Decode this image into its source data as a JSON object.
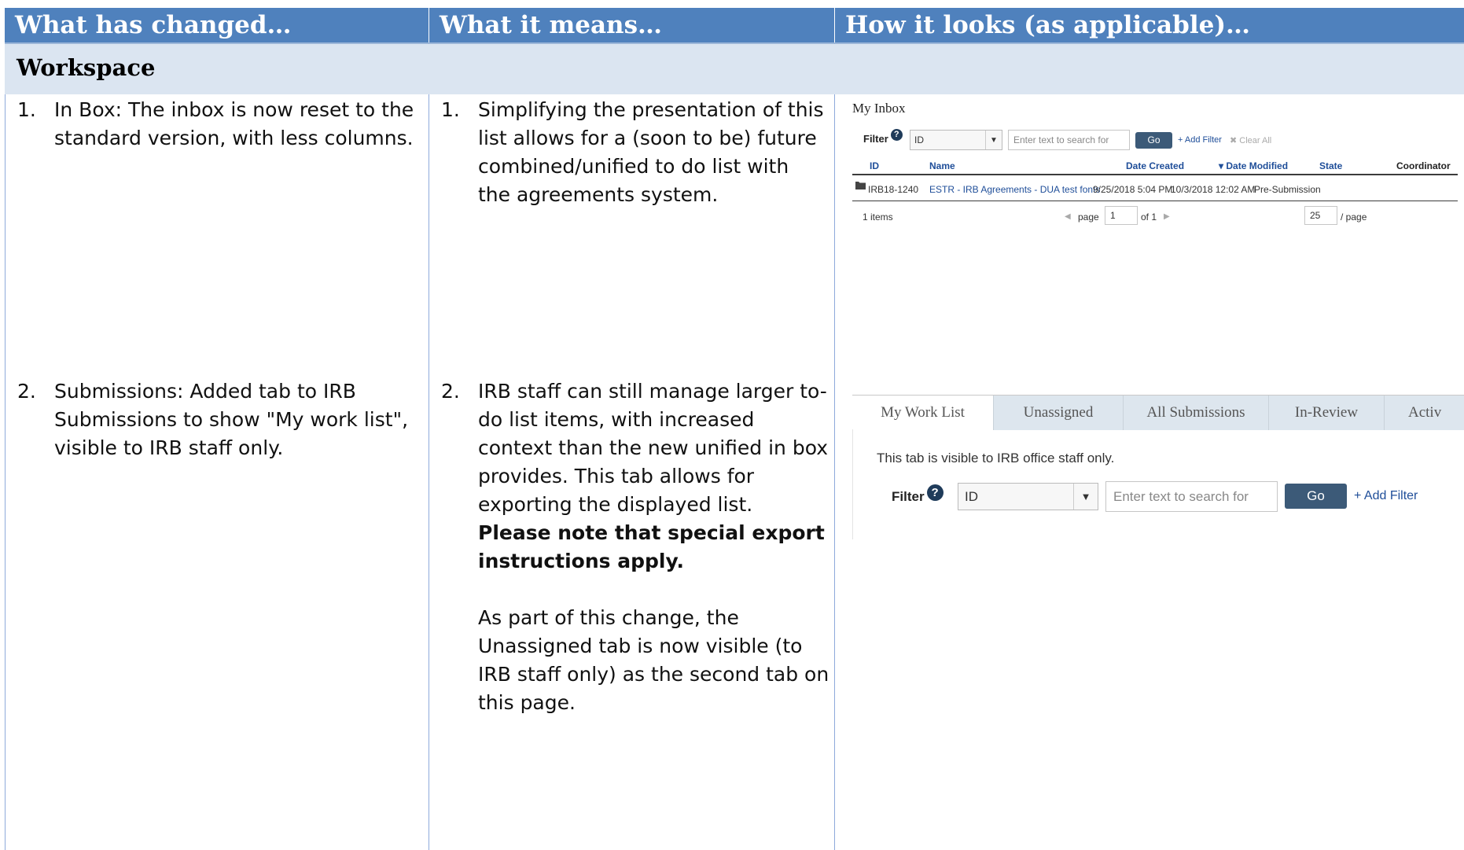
{
  "headers": [
    "What has changed…",
    "What it means…",
    "How it looks (as applicable)…"
  ],
  "section_title": "Workspace",
  "rows": [
    {
      "number": "1.",
      "change": "In Box: The inbox is now reset to the standard version, with less columns.",
      "meaning_number": "1.",
      "meaning": "Simplifying the presentation of this list allows for a (soon to be) future combined/unified to do list with the agreements system."
    },
    {
      "number": "2.",
      "change": "Submissions: Added tab to IRB Submissions to show \"My work list\", visible to IRB staff only.",
      "meaning_number": "2.",
      "meaning": "IRB staff can still manage larger to-do list items, with increased context than the new unified in box provides.  This tab allows for exporting the displayed list.",
      "meaning_bold": "Please note that special export instructions apply.",
      "meaning_extra": "As part of this change, the Unassigned tab is now visible (to IRB staff only) as the second tab on this page."
    }
  ],
  "inbox": {
    "title": "My Inbox",
    "filter_label": "Filter",
    "help": "?",
    "filter_select": "ID",
    "search_placeholder": "Enter text to search for",
    "go": "Go",
    "add_filter": "+ Add Filter",
    "clear_all": "✖ Clear All",
    "columns": [
      "ID",
      "Name",
      "Date Created",
      "▾ Date Modified",
      "State",
      "Coordinator"
    ],
    "row": {
      "id": "IRB18-1240",
      "name": "ESTR - IRB Agreements - DUA test fonts",
      "date_created": "9/25/2018 5:04 PM",
      "date_modified": "10/3/2018 12:02 AM",
      "state": "Pre-Submission",
      "coordinator": ""
    },
    "items": "1 items",
    "page_label": "page",
    "page_value": "1",
    "of_label": "of 1",
    "per_page_value": "25",
    "per_page_label": "/ page"
  },
  "worklist": {
    "tabs": [
      "My Work List",
      "Unassigned",
      "All Submissions",
      "In-Review",
      "Activ"
    ],
    "active_tab": 0,
    "notice": "This tab is visible to IRB office staff only.",
    "filter_label": "Filter",
    "help": "?",
    "filter_select": "ID",
    "search_placeholder": "Enter text to search for",
    "go": "Go",
    "add_filter": "+ Add Filter"
  },
  "colors": {
    "header_bg": "#4f81bd",
    "section_bg": "#dbe5f1",
    "go_button": "#3c5a78",
    "link": "#1f4e99"
  }
}
